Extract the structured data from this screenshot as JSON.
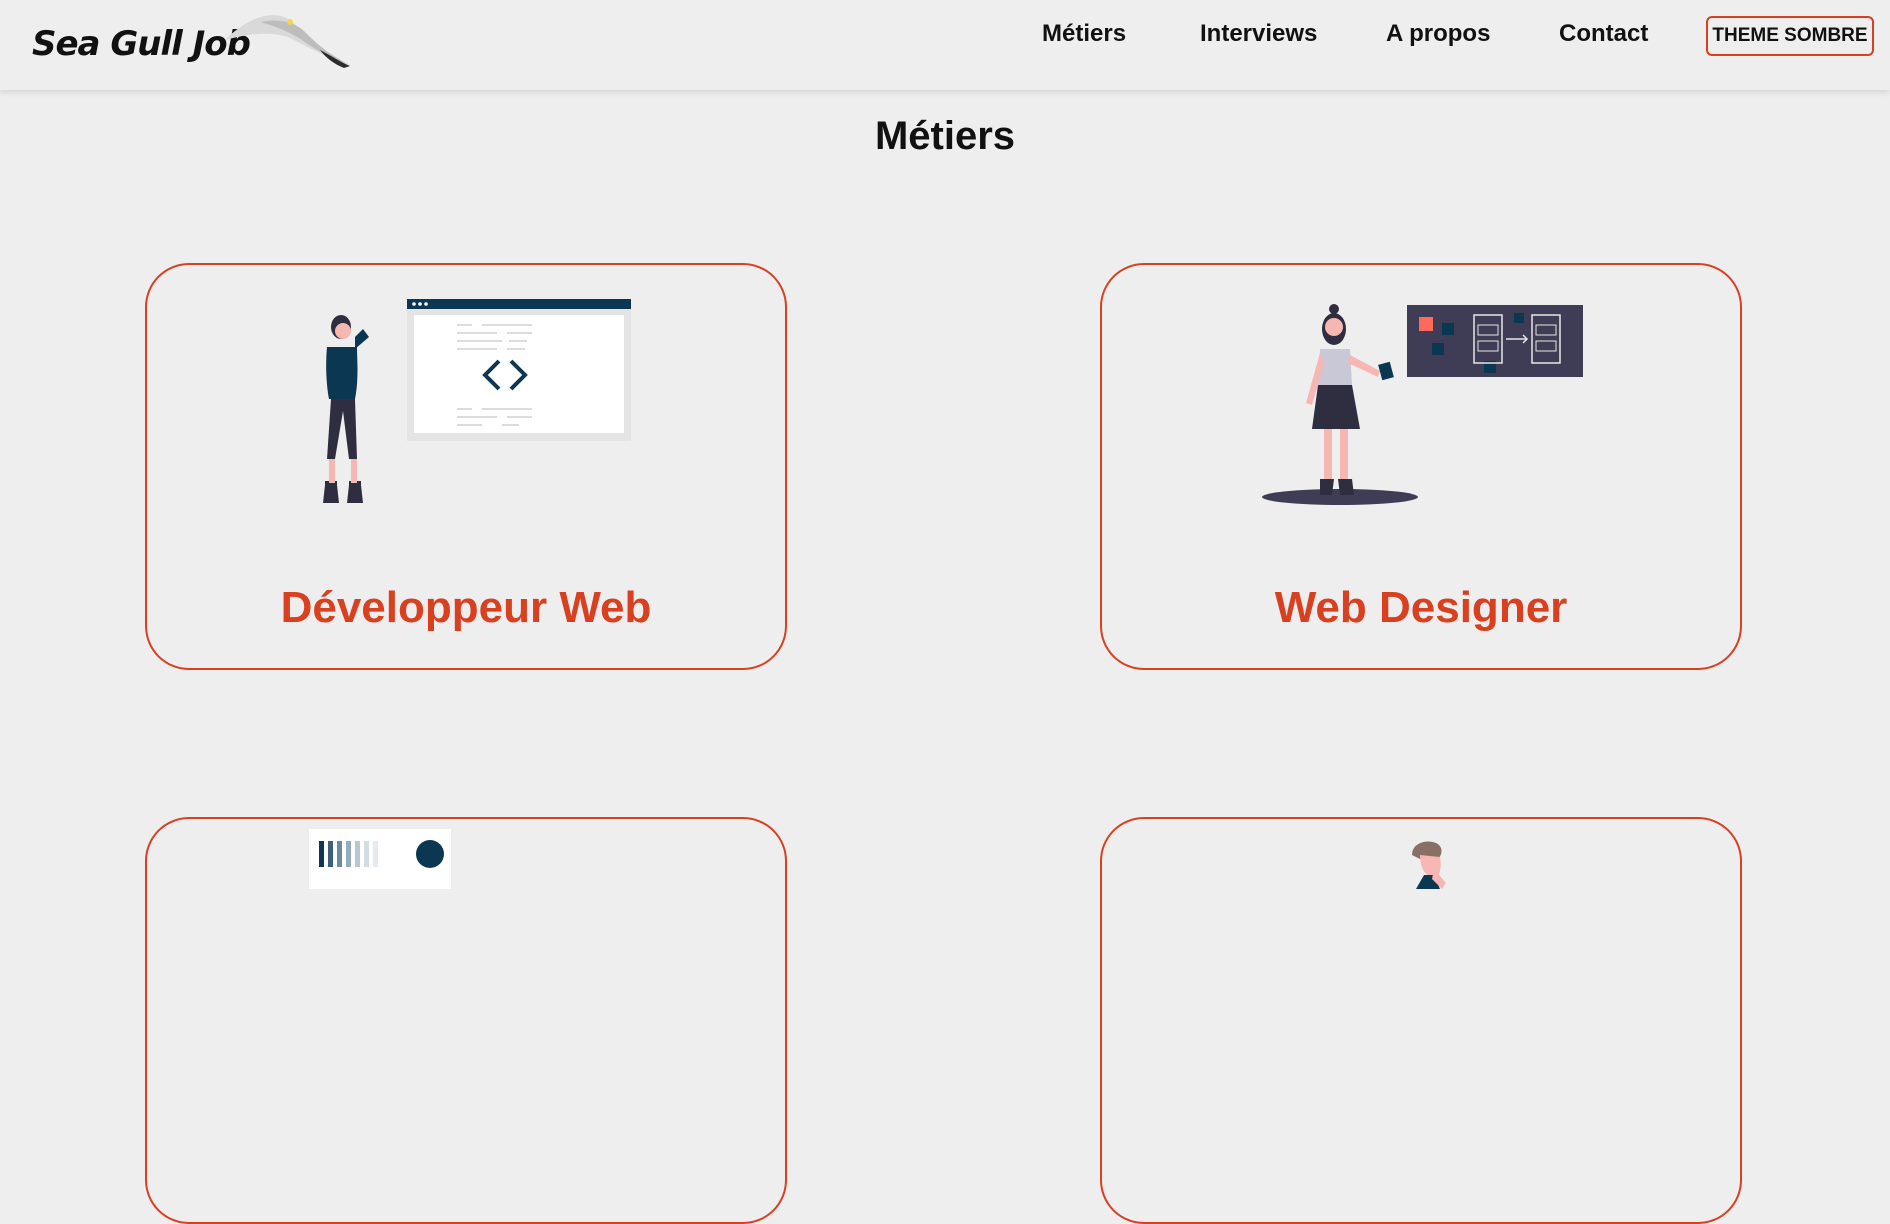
{
  "brand": {
    "name": "Sea Gull Job"
  },
  "nav": {
    "items": [
      {
        "label": "Métiers"
      },
      {
        "label": "Interviews"
      },
      {
        "label": "A propos"
      },
      {
        "label": "Contact"
      }
    ],
    "theme_button": "THEME SOMBRE"
  },
  "page": {
    "title": "Métiers"
  },
  "cards": [
    {
      "title": "Développeur Web",
      "illustration": "developer-illustration"
    },
    {
      "title": "Web Designer",
      "illustration": "designer-illustration"
    },
    {
      "title": "",
      "illustration": "chart-illustration"
    },
    {
      "title": "",
      "illustration": "person-illustration"
    }
  ],
  "colors": {
    "accent": "#d8401f",
    "background": "#efeeee",
    "navy": "#0c3753",
    "text": "#111111"
  }
}
